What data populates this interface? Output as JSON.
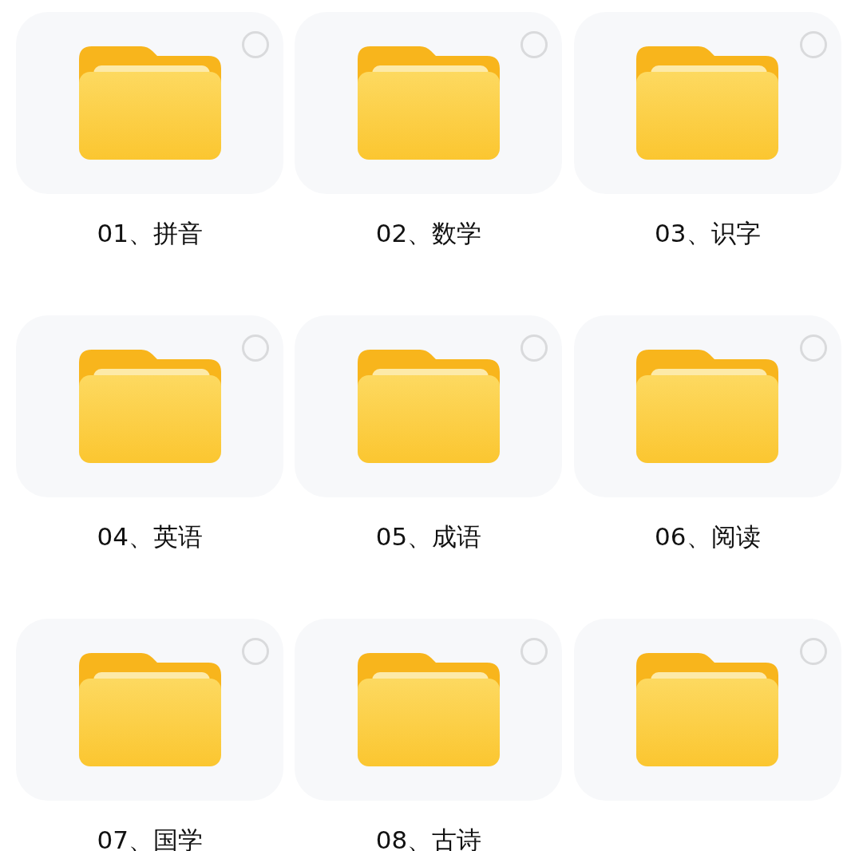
{
  "folders": [
    {
      "label": "01、拼音",
      "selected": false
    },
    {
      "label": "02、数学",
      "selected": false
    },
    {
      "label": "03、识字",
      "selected": false
    },
    {
      "label": "04、英语",
      "selected": false
    },
    {
      "label": "05、成语",
      "selected": false
    },
    {
      "label": "06、阅读",
      "selected": false
    },
    {
      "label": "07、国学",
      "selected": false
    },
    {
      "label": "08、古诗",
      "selected": false
    },
    {
      "selected": false
    }
  ]
}
